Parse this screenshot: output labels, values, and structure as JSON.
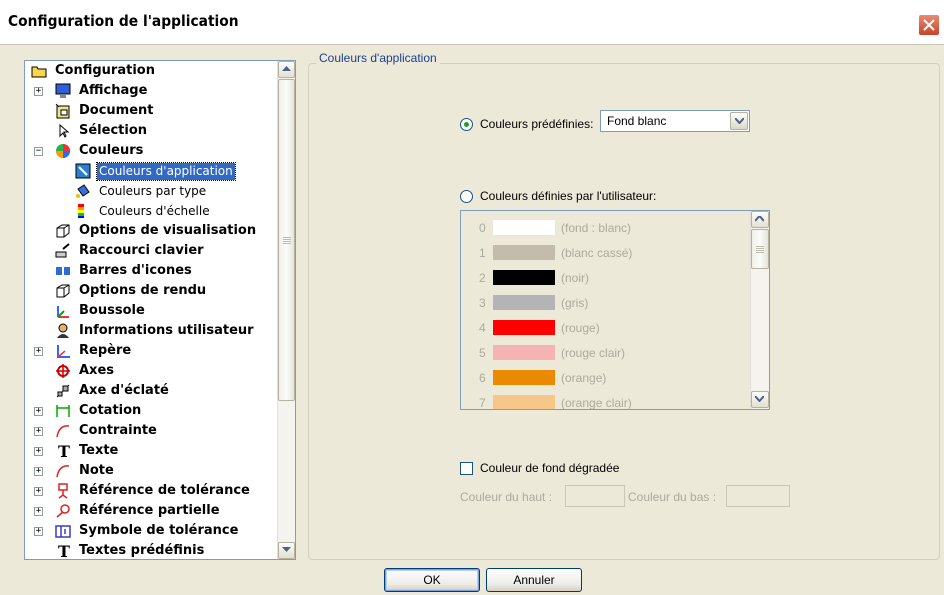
{
  "window": {
    "title": "Configuration de l'application"
  },
  "tree": {
    "items": [
      {
        "label": "Configuration",
        "level": 0,
        "expander": "",
        "icon": "folder-icon"
      },
      {
        "label": "Affichage",
        "level": 1,
        "expander": "+",
        "icon": "monitor-icon"
      },
      {
        "label": "Document",
        "level": 1,
        "expander": "",
        "icon": "document-icon"
      },
      {
        "label": "Sélection",
        "level": 1,
        "expander": "",
        "icon": "cursor-icon"
      },
      {
        "label": "Couleurs",
        "level": 1,
        "expander": "−",
        "icon": "color-wheel-icon"
      },
      {
        "label": "Couleurs d'application",
        "level": 2,
        "expander": "",
        "icon": "palette-icon",
        "selected": true
      },
      {
        "label": "Couleurs par type",
        "level": 2,
        "expander": "",
        "icon": "paint-bucket-icon"
      },
      {
        "label": "Couleurs d'échelle",
        "level": 2,
        "expander": "",
        "icon": "gradient-scale-icon"
      },
      {
        "label": "Options de visualisation",
        "level": 1,
        "expander": "",
        "icon": "cube-icon"
      },
      {
        "label": "Raccourci clavier",
        "level": 1,
        "expander": "",
        "icon": "keyboard-shortcut-icon"
      },
      {
        "label": "Barres d'icones",
        "level": 1,
        "expander": "",
        "icon": "toolbar-icon"
      },
      {
        "label": "Options de rendu",
        "level": 1,
        "expander": "",
        "icon": "render-cube-icon"
      },
      {
        "label": "Boussole",
        "level": 1,
        "expander": "",
        "icon": "compass-icon"
      },
      {
        "label": "Informations utilisateur",
        "level": 1,
        "expander": "",
        "icon": "user-icon"
      },
      {
        "label": "Repère",
        "level": 1,
        "expander": "+",
        "icon": "axis-frame-icon"
      },
      {
        "label": "Axes",
        "level": 1,
        "expander": "",
        "icon": "axes-icon"
      },
      {
        "label": "Axe d'éclaté",
        "level": 1,
        "expander": "",
        "icon": "explode-axis-icon"
      },
      {
        "label": "Cotation",
        "level": 1,
        "expander": "+",
        "icon": "dimension-icon"
      },
      {
        "label": "Contrainte",
        "level": 1,
        "expander": "+",
        "icon": "constraint-icon"
      },
      {
        "label": "Texte",
        "level": 1,
        "expander": "+",
        "icon": "text-icon"
      },
      {
        "label": "Note",
        "level": 1,
        "expander": "+",
        "icon": "note-icon"
      },
      {
        "label": "Référence de tolérance",
        "level": 1,
        "expander": "+",
        "icon": "tolerance-reference-icon"
      },
      {
        "label": "Référence partielle",
        "level": 1,
        "expander": "+",
        "icon": "partial-reference-icon"
      },
      {
        "label": "Symbole de tolérance",
        "level": 1,
        "expander": "+",
        "icon": "tolerance-symbol-icon"
      },
      {
        "label": "Textes prédéfinis",
        "level": 1,
        "expander": "",
        "icon": "text-icon"
      }
    ]
  },
  "panel": {
    "group_title": "Couleurs d'application",
    "predefined_label": "Couleurs prédéfinies:",
    "predefined_value": "Fond blanc",
    "predefined_selected": true,
    "user_label": "Couleurs définies par l'utilisateur:",
    "user_selected": false,
    "colors": [
      {
        "index": "0",
        "name": "(fond : blanc)",
        "hex": "#ffffff"
      },
      {
        "index": "1",
        "name": "(blanc cassé)",
        "hex": "#c3bbac"
      },
      {
        "index": "2",
        "name": "(noir)",
        "hex": "#000000"
      },
      {
        "index": "3",
        "name": "(gris)",
        "hex": "#b4b4b4"
      },
      {
        "index": "4",
        "name": "(rouge)",
        "hex": "#ff0000"
      },
      {
        "index": "5",
        "name": "(rouge clair)",
        "hex": "#f5b3b3"
      },
      {
        "index": "6",
        "name": "(orange)",
        "hex": "#e98a00"
      },
      {
        "index": "7",
        "name": "(orange clair)",
        "hex": "#f6c789"
      }
    ],
    "gradient_label": "Couleur de fond dégradée",
    "gradient_checked": false,
    "top_color_label": "Couleur du haut :",
    "bottom_color_label": "Couleur du bas :"
  },
  "buttons": {
    "ok": "OK",
    "cancel": "Annuler"
  },
  "colors": {
    "accent": "#316ac5",
    "group_title": "#1c3f94",
    "disabled_text": "#acaa9d"
  }
}
